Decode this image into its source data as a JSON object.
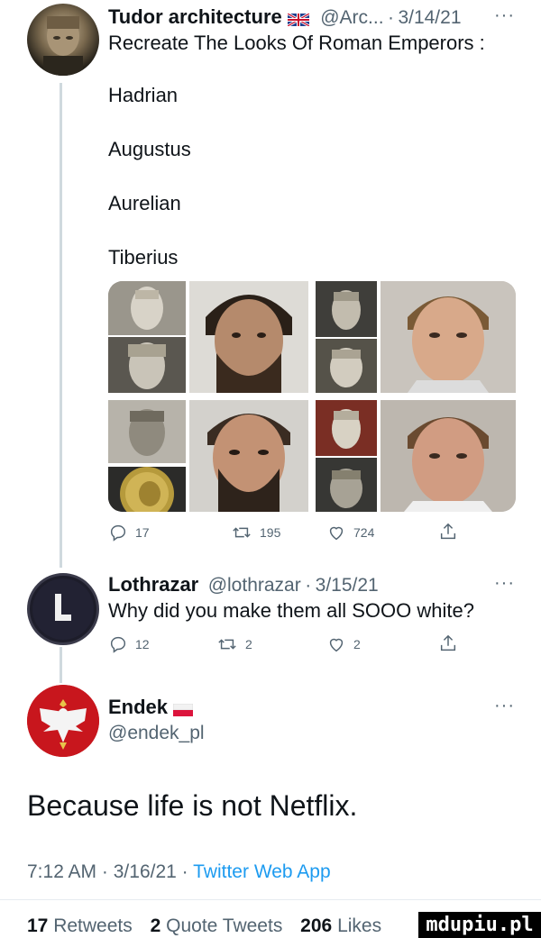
{
  "tweet1": {
    "author_name": "Tudor architecture",
    "handle": "@Arc...",
    "date": "3/14/21",
    "more": "···",
    "lines": [
      "Recreate The Looks Of Roman Emperors :",
      "Hadrian",
      "Augustus",
      "Aurelian",
      "Tiberius"
    ],
    "actions": {
      "replies": "17",
      "retweets": "195",
      "likes": "724"
    },
    "icons": {
      "reply": "reply-icon",
      "retweet": "retweet-icon",
      "like": "heart-icon",
      "share": "share-icon"
    }
  },
  "tweet2": {
    "author_name": "Lothrazar",
    "handle": "@lothrazar",
    "date": "3/15/21",
    "separator": "·",
    "more": "···",
    "text": "Why did you make them all SOOO white?",
    "actions": {
      "replies": "12",
      "retweets": "2",
      "likes": "2"
    }
  },
  "main_tweet": {
    "author_name": "Endek",
    "handle": "@endek_pl",
    "more": "···",
    "text": "Because life is not Netflix.",
    "time": "7:12 AM",
    "date": "3/16/21",
    "separator": "·",
    "source": "Twitter Web App",
    "stats": {
      "retweets_count": "17",
      "retweets_label": "Retweets",
      "quotes_count": "2",
      "quotes_label": "Quote Tweets",
      "likes_count": "206",
      "likes_label": "Likes"
    }
  },
  "watermark": "mdupiu.pl",
  "colors": {
    "text": "#0f1419",
    "secondary": "#536471",
    "link": "#1d9bf0",
    "line": "#cfd9de"
  }
}
